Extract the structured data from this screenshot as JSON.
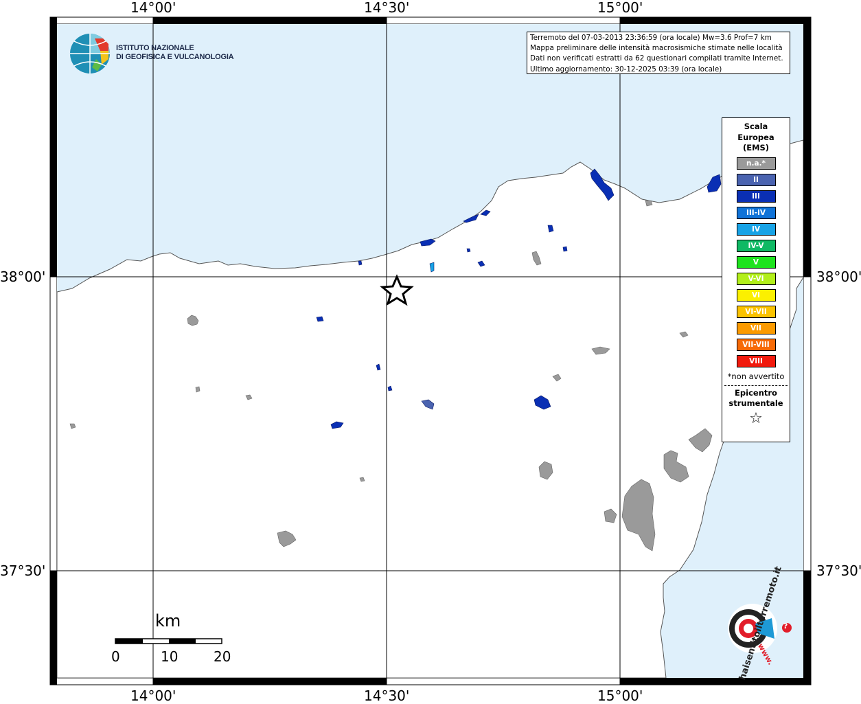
{
  "map": {
    "title": "Terremoto del 07-03-2013 23:36:59 (ora locale) Mw=3.6 Prof=7 km",
    "info_lines": [
      "Terremoto del 07-03-2013 23:36:59 (ora locale) Mw=3.6 Prof=7 km",
      "Mappa preliminare delle intensità macrosismiche stimate nelle località",
      "Dati non verificati estratti da 62 questionari compilati tramite Internet.",
      "Ultimo aggiornamento: 30-12-2025 03:39 (ora locale)"
    ],
    "colors": {
      "sea": "#dff0fb",
      "land": "#ffffff",
      "grid": "#000000",
      "no_data": "#9a9a9a"
    }
  },
  "org_logo": {
    "line1": "ISTITUTO NAZIONALE",
    "line2": "DI GEOFISICA E VULCANOLOGIA"
  },
  "axes": {
    "lon_top": [
      "14°00'",
      "14°30'",
      "15°00'"
    ],
    "lon_bottom": [
      "14°00'",
      "14°30'",
      "15°00'"
    ],
    "lat_left": [
      "38°00'",
      "37°30'"
    ],
    "lat_right": [
      "38°00'",
      "37°30'"
    ]
  },
  "legend": {
    "title_lines": [
      "Scala",
      "Europea",
      "(EMS)"
    ],
    "items": [
      {
        "label": "n.a.*",
        "color": "#9a9a9a"
      },
      {
        "label": "II",
        "color": "#4a63b0"
      },
      {
        "label": "III",
        "color": "#0a2fb4"
      },
      {
        "label": "III-IV",
        "color": "#1073d8"
      },
      {
        "label": "IV",
        "color": "#18a3e6"
      },
      {
        "label": "IV-V",
        "color": "#0fb964"
      },
      {
        "label": "V",
        "color": "#1ee31e"
      },
      {
        "label": "V-VI",
        "color": "#b2ef1a"
      },
      {
        "label": "VI",
        "color": "#fbf000"
      },
      {
        "label": "VI-VII",
        "color": "#fbc300"
      },
      {
        "label": "VII",
        "color": "#fb9a00"
      },
      {
        "label": "VII-VIII",
        "color": "#f76a06"
      },
      {
        "label": "VIII",
        "color": "#f11a0d"
      }
    ],
    "na_note": "*non avvertito",
    "epicenter_lines": [
      "Epicentro",
      "strumentale"
    ],
    "epicenter_symbol": "☆"
  },
  "scale_bar": {
    "unit": "km",
    "ticks": [
      "0",
      "10",
      "20"
    ]
  },
  "site_badge": {
    "text": "haisentitoilterremoto.it",
    "prefix": "www.",
    "question_mark": "?"
  },
  "localities": [
    {
      "intensity": "n.a.*"
    },
    {
      "intensity": "III"
    },
    {
      "intensity": "IV"
    },
    {
      "intensity": "II"
    }
  ]
}
